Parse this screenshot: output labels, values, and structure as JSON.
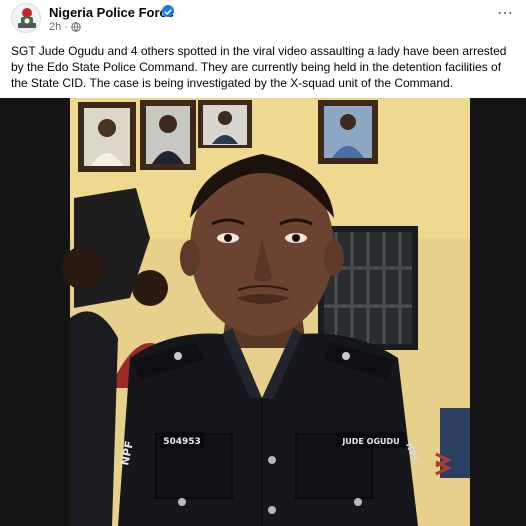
{
  "post": {
    "author": "Nigeria Police Force",
    "time": "2h",
    "separator": "·",
    "privacy_icon": "globe-icon",
    "verified_icon": "verified-badge-icon",
    "more_icon": "more-options-icon",
    "text": "SGT Jude Ogudu and 4 others spotted in the viral video assaulting a lady have been arrested by the Edo State Police Command. They are currently being held in the detention facilities of the State CID. The case is being investigated by the X-squad unit of the Command."
  },
  "photo": {
    "shoulder_patch": "NPF",
    "shoulder_patch_right": "NPF",
    "service_number": "504953",
    "name_tag": "JUDE OGUDU"
  },
  "colors": {
    "accent": "#1877f2",
    "secondary_text": "#65676b",
    "wall": "#e9d48e",
    "uniform": "#15171d"
  }
}
